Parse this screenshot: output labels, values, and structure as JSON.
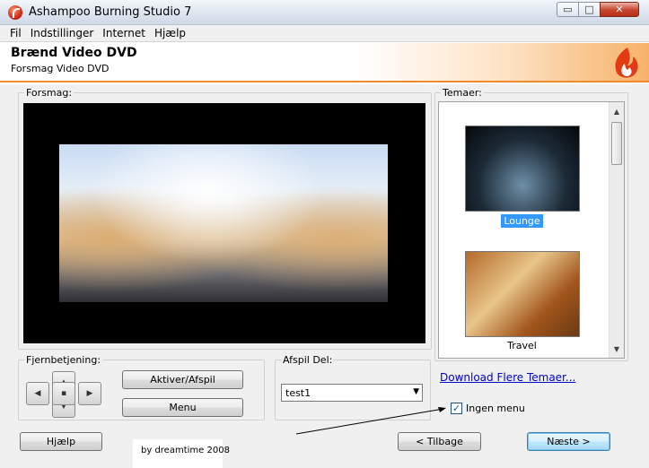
{
  "window": {
    "title": "Ashampoo Burning Studio 7",
    "controls": {
      "minimize": "▭",
      "maximize": "□",
      "close": "✕"
    }
  },
  "menu": [
    "Fil",
    "Indstillinger",
    "Internet",
    "Hjælp"
  ],
  "header": {
    "title": "Brænd Video DVD",
    "subtitle": "Forsmag Video DVD"
  },
  "preview": {
    "label": "Forsmag:"
  },
  "themes": {
    "label": "Temaer:",
    "items": [
      {
        "name": "Lounge",
        "selected": true
      },
      {
        "name": "Travel",
        "selected": false
      }
    ],
    "download_link": "Download Flere Temaer..."
  },
  "remote": {
    "label": "Fjernbetjening:",
    "activate_button": "Aktiver/Afspil",
    "menu_button": "Menu"
  },
  "play_part": {
    "label": "Afspil Del:",
    "selected": "test1"
  },
  "no_menu": {
    "label": "Ingen menu",
    "checked": true
  },
  "footer": {
    "help": "Hjælp",
    "back": "< Tilbage",
    "next": "Næste >"
  },
  "annotation": {
    "text": "by dreamtime 2008"
  }
}
